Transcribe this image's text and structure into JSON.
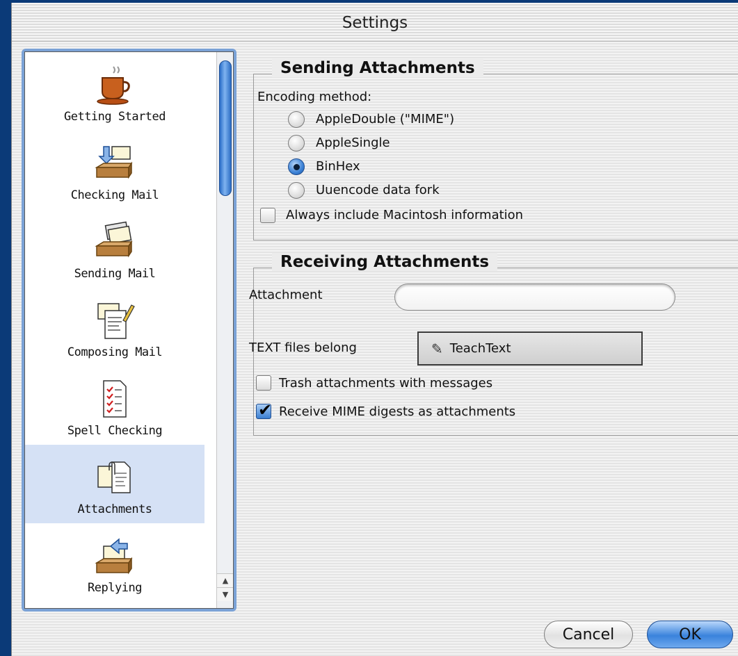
{
  "window": {
    "title": "Settings"
  },
  "sidebar": {
    "items": [
      {
        "label": "Getting Started",
        "icon": "coffee-cup-icon",
        "selected": false
      },
      {
        "label": "Checking Mail",
        "icon": "mailbox-download-icon",
        "selected": false
      },
      {
        "label": "Sending Mail",
        "icon": "mailbox-send-icon",
        "selected": false
      },
      {
        "label": "Composing Mail",
        "icon": "compose-pencil-icon",
        "selected": false
      },
      {
        "label": "Spell Checking",
        "icon": "checklist-icon",
        "selected": false
      },
      {
        "label": "Attachments",
        "icon": "attachment-documents-icon",
        "selected": true
      },
      {
        "label": "Replying",
        "icon": "reply-arrow-icon",
        "selected": false
      }
    ],
    "scroll_up_arrow": "▲",
    "scroll_down_arrow": "▼"
  },
  "sending": {
    "title": "Sending Attachments",
    "encoding_label": "Encoding method:",
    "options": [
      {
        "label": "AppleDouble (\"MIME\")",
        "selected": false
      },
      {
        "label": "AppleSingle",
        "selected": false
      },
      {
        "label": "BinHex",
        "selected": true
      },
      {
        "label": "Uuencode data fork",
        "selected": false
      }
    ],
    "mac_info": {
      "label": "Always include Macintosh information",
      "checked": false
    }
  },
  "receiving": {
    "title": "Receiving Attachments",
    "attachment_label": "Attachment",
    "attachment_value": "",
    "text_files_label": "TEXT files belong",
    "text_files_app": "TeachText",
    "text_files_app_icon": "teachtext-icon",
    "trash": {
      "label": "Trash attachments with messages",
      "checked": false
    },
    "mime_digests": {
      "label": "Receive MIME digests as attachments",
      "checked": true
    },
    "checkmark": "✔"
  },
  "buttons": {
    "cancel": "Cancel",
    "ok": "OK"
  },
  "colors": {
    "accent": "#3a83dc",
    "selection": "#d5e1f5",
    "sidebar_frame": "#7ba2d6"
  }
}
